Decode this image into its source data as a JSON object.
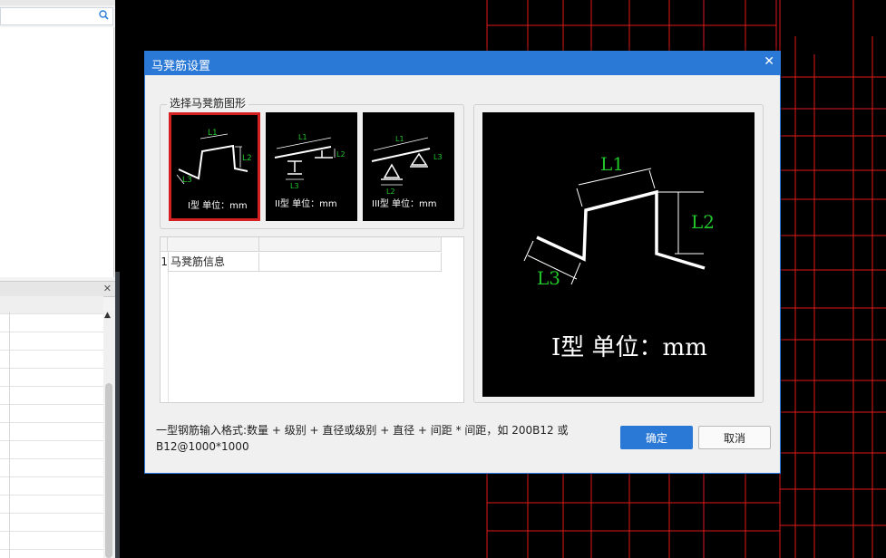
{
  "dialog": {
    "title": "马凳筋设置",
    "group_label": "选择马凳筋图形",
    "shapes": [
      {
        "caption": "I型 单位：mm",
        "selected": true
      },
      {
        "caption": "II型 单位：mm",
        "selected": false
      },
      {
        "caption": "III型 单位：mm",
        "selected": false
      }
    ],
    "shape_labels": {
      "l1": "L1",
      "l2": "L2",
      "l3": "L3"
    },
    "table": {
      "rows": [
        {
          "index": "1",
          "name": "马凳筋信息",
          "value": ""
        }
      ]
    },
    "preview": {
      "caption": "I型 单位：mm"
    },
    "hint": "一型钢筋输入格式:数量 + 级别 + 直径或级别 + 直径 + 间距 * 间距，如 200B12 或 B12@1000*1000",
    "ok_label": "确定",
    "cancel_label": "取消"
  },
  "colors": {
    "title_bar": "#2b79d6",
    "selected_border": "#d42020",
    "dimension_text": "#22c52a",
    "cad_grid": "#e01818",
    "cad_background": "#000000"
  },
  "icons": {
    "search": "search-icon",
    "close": "close-icon",
    "scroll_up": "arrow-up-icon"
  }
}
